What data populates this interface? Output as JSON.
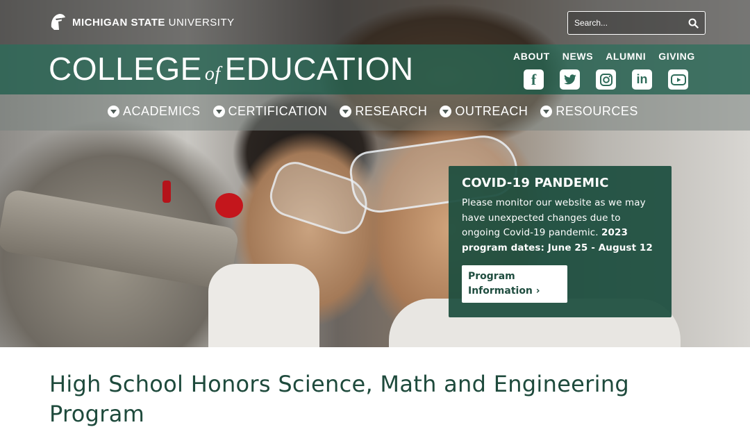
{
  "brand": {
    "university_bold": "MICHIGAN STATE",
    "university_light": "UNIVERSITY",
    "college_pre": "COLLEGE",
    "college_of": "of",
    "college_post": "EDUCATION"
  },
  "search": {
    "placeholder": "Search..."
  },
  "utility_nav": [
    "ABOUT",
    "NEWS",
    "ALUMNI",
    "GIVING"
  ],
  "social": [
    {
      "icon": "facebook-icon",
      "glyph": "f"
    },
    {
      "icon": "twitter-icon",
      "glyph": "t"
    },
    {
      "icon": "instagram-icon",
      "glyph": "◎"
    },
    {
      "icon": "linkedin-icon",
      "glyph": "in"
    },
    {
      "icon": "youtube-icon",
      "glyph": "▶"
    }
  ],
  "main_nav": [
    "ACADEMICS",
    "CERTIFICATION",
    "RESEARCH",
    "OUTREACH",
    "RESOURCES"
  ],
  "covid": {
    "heading": "COVID-19 PANDEMIC",
    "body": "Please monitor our website as we may have unexpected changes due to ongoing Covid-19 pandemic.",
    "dates": "2023 program dates: June 25 - August 12",
    "button_line1": "Program",
    "button_line2": "Information ›"
  },
  "page_title": "High School Honors Science, Math and Engineering Program",
  "colors": {
    "msu_green": "#18453b",
    "band_green": "#266150",
    "heading_green": "#1e4a3c"
  }
}
